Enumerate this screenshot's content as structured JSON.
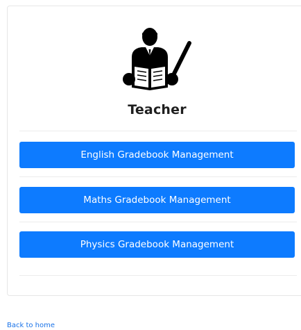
{
  "card": {
    "role_title": "Teacher",
    "icon": "teacher-with-pointer-icon",
    "buttons": [
      {
        "label": "English Gradebook Management"
      },
      {
        "label": "Maths Gradebook Management"
      },
      {
        "label": "Physics Gradebook Management"
      }
    ]
  },
  "footer": {
    "back_link": "Back to home"
  },
  "colors": {
    "button_bg": "#0d7bff",
    "button_text": "#ffffff",
    "title_text": "#1f1f1f",
    "link": "#1a73e8"
  }
}
